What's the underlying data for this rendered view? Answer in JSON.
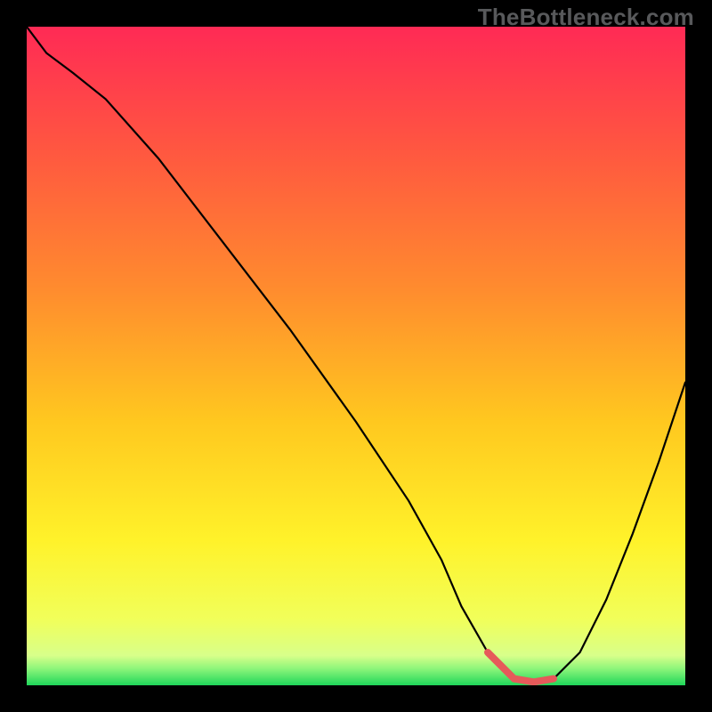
{
  "watermark": {
    "text": "TheBottleneck.com"
  },
  "colors": {
    "frame_bg": "#000000",
    "curve": "#000000",
    "highlight": "#e65a5a"
  },
  "gradient_stops": [
    {
      "offset": 0.0,
      "color": "#ff2a55"
    },
    {
      "offset": 0.2,
      "color": "#ff5a3f"
    },
    {
      "offset": 0.4,
      "color": "#ff8c2e"
    },
    {
      "offset": 0.6,
      "color": "#ffc81f"
    },
    {
      "offset": 0.78,
      "color": "#fff22a"
    },
    {
      "offset": 0.9,
      "color": "#f1ff5a"
    },
    {
      "offset": 0.955,
      "color": "#d8ff8a"
    },
    {
      "offset": 0.975,
      "color": "#8cf57a"
    },
    {
      "offset": 1.0,
      "color": "#1fd65a"
    }
  ],
  "chart_data": {
    "type": "line",
    "title": "",
    "xlabel": "",
    "ylabel": "",
    "xlim": [
      0,
      100
    ],
    "ylim": [
      0,
      100
    ],
    "series": [
      {
        "name": "bottleneck_curve",
        "x": [
          0,
          3,
          7,
          12,
          20,
          30,
          40,
          50,
          58,
          63,
          66,
          70,
          74,
          77,
          80,
          84,
          88,
          92,
          96,
          100
        ],
        "y": [
          100,
          96,
          93,
          89,
          80,
          67,
          54,
          40,
          28,
          19,
          12,
          5,
          1,
          0.5,
          1,
          5,
          13,
          23,
          34,
          46
        ]
      }
    ],
    "highlight": {
      "x": [
        70,
        74,
        77,
        80
      ],
      "y": [
        5,
        1,
        0.5,
        1
      ],
      "stroke_width": 8
    }
  }
}
